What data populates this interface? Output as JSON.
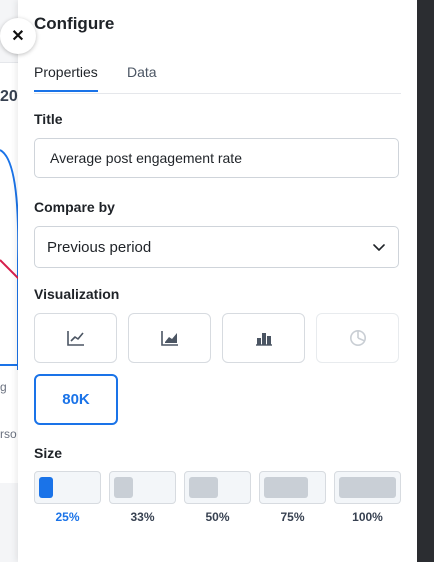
{
  "background": {
    "year_fragment": "20",
    "label_fragment_1": "g",
    "label_fragment_2": "rso"
  },
  "panel": {
    "title": "Configure",
    "close_icon": "close-icon",
    "tabs": [
      {
        "label": "Properties",
        "active": true
      },
      {
        "label": "Data",
        "active": false
      }
    ],
    "title_field": {
      "label": "Title",
      "value": "Average post engagement rate"
    },
    "compare_by": {
      "label": "Compare by",
      "selected": "Previous period",
      "icon": "chevron-down-icon"
    },
    "visualization": {
      "label": "Visualization",
      "options": [
        {
          "icon": "line-chart-icon",
          "disabled": false
        },
        {
          "icon": "area-chart-icon",
          "disabled": false
        },
        {
          "icon": "bar-chart-icon",
          "disabled": false
        },
        {
          "icon": "pie-chart-icon",
          "disabled": true
        }
      ],
      "kpi_option": {
        "label": "80K",
        "selected": true
      }
    },
    "size": {
      "label": "Size",
      "options": [
        {
          "label": "25%",
          "value": 0.25,
          "selected": true
        },
        {
          "label": "33%",
          "value": 0.33,
          "selected": false
        },
        {
          "label": "50%",
          "value": 0.5,
          "selected": false
        },
        {
          "label": "75%",
          "value": 0.75,
          "selected": false
        },
        {
          "label": "100%",
          "value": 1.0,
          "selected": false
        }
      ]
    }
  },
  "colors": {
    "accent": "#1a73e8",
    "border": "#cfd4da",
    "dark_strip": "#2b2d31"
  }
}
